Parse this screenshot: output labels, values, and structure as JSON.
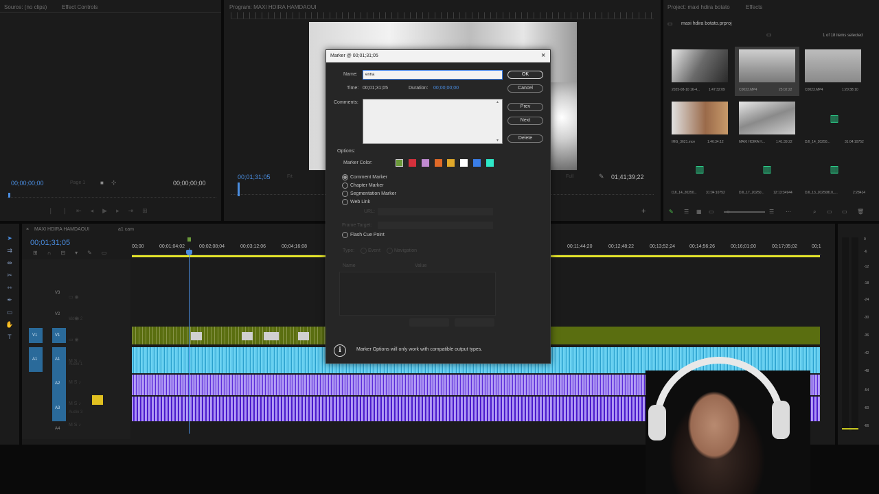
{
  "source_panel": {
    "tab_source": "Source: (no clips)",
    "tab_effect_controls": "Effect Controls",
    "timecode_left": "00;00;00;00",
    "page": "Page 1",
    "timecode_right": "00;00;00;00"
  },
  "program_panel": {
    "title": "Program: MAXI HDIRA HAMDAOUI",
    "timecode_left": "00;01;31;05",
    "fit": "Fit",
    "full": "Full",
    "timecode_right": "01;41;39;22"
  },
  "project_panel": {
    "tab_project": "Project: maxi hdira botato",
    "tab_effects": "Effects",
    "filename": "maxi hdira botato.prproj",
    "items_count": "1 of 18 items selected",
    "items": [
      {
        "caption": "2025-08-10 16-4...",
        "duration": "1:47:32:09"
      },
      {
        "caption": "C0033.MP4",
        "duration": "25:02:22"
      },
      {
        "caption": "C0023.MP4",
        "duration": "1:20:38:10"
      },
      {
        "caption": "IMG_3621.mov",
        "duration": "1:46:34:12"
      },
      {
        "caption": "MAXI HDIRA H...",
        "duration": "1:41:39:22"
      },
      {
        "caption": "DJI_14_20250...",
        "duration": "31:04:10752"
      },
      {
        "caption": "DJI_14_20250...",
        "duration": "31:04:10752"
      },
      {
        "caption": "DJI_17_20250...",
        "duration": "12:13:34944"
      },
      {
        "caption": "DJI_13_20250810_...",
        "duration": "2:28414"
      }
    ]
  },
  "timeline": {
    "tab_active": "MAXI HDIRA HAMDAOUI",
    "tab_other": "a1 cam",
    "timecode": "00;01;31;05",
    "ruler_left": [
      "00;00",
      "00;01;04;02",
      "00;02;08;04",
      "00;03;12;06",
      "00;04;16;08"
    ],
    "ruler_right": [
      "00;11;44;20",
      "00;12;48;22",
      "00;13;52;24",
      "00;14;56;26",
      "00;16;01;00",
      "00;17;05;02",
      "00;1"
    ],
    "tracks": {
      "v3": "V3",
      "v2": "V2",
      "v1": "V1",
      "v1_source": "V1",
      "a1": "A1",
      "a1_source": "A1",
      "a2": "A2",
      "a3": "A3",
      "a4": "A4",
      "v2_name": "Video 2",
      "a1_name": "Audio 1",
      "a3_name": "Audio 3"
    },
    "meter_scale": [
      "0",
      "-6",
      "-12",
      "-18",
      "-24",
      "-30",
      "-36",
      "-42",
      "-48",
      "-54",
      "-60",
      "-66"
    ]
  },
  "marker_dialog": {
    "title": "Marker @ 00;01;31;05",
    "name_label": "Name:",
    "name_value": "enha",
    "time_label": "Time:",
    "time_value": "00;01;31;05",
    "duration_label": "Duration:",
    "duration_value": "00;00;00;00",
    "comments_label": "Comments:",
    "comments_value": "",
    "ok": "OK",
    "cancel": "Cancel",
    "prev": "Prev",
    "next": "Next",
    "delete": "Delete",
    "options_label": "Options:",
    "marker_color_label": "Marker Color:",
    "marker_colors": [
      "#6b9a3a",
      "#d4303c",
      "#c08ad0",
      "#e06a28",
      "#e0a82a",
      "#ffffff",
      "#3a7ee8",
      "#2ee8c8"
    ],
    "types": [
      "Comment Marker",
      "Chapter Marker",
      "Segmentation Marker",
      "Web Link"
    ],
    "url_label": "URL:",
    "frame_target_label": "Frame Target:",
    "flash_cue": "Flash Cue Point",
    "type_label": "Type:",
    "event": "Event",
    "navigation": "Navigation",
    "name_col": "Name",
    "value_col": "Value",
    "footer_note": "Marker Options will only work with compatible output types."
  }
}
